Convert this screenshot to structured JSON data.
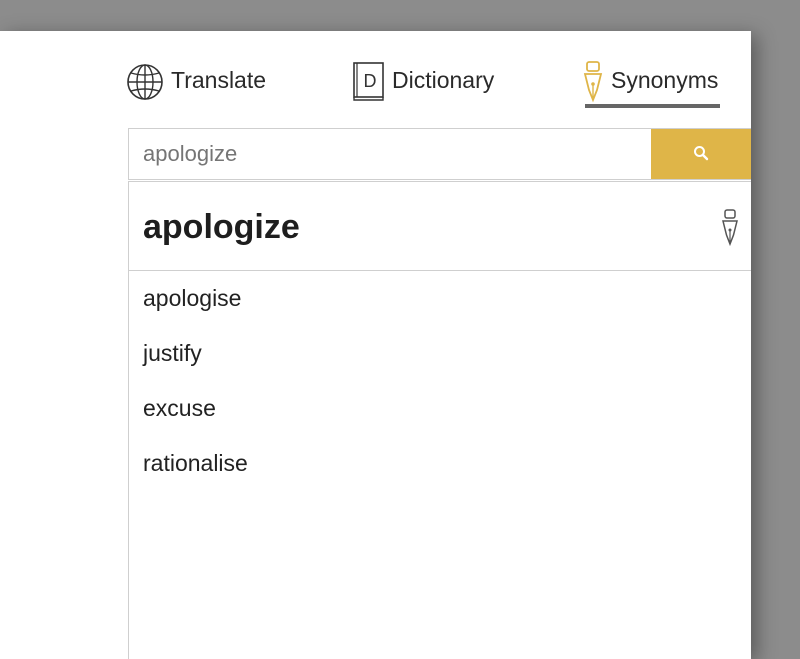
{
  "tabs": {
    "translate": {
      "label": "Translate",
      "icon": "globe-icon"
    },
    "dictionary": {
      "label": "Dictionary",
      "icon": "book-icon"
    },
    "synonyms": {
      "label": "Synonyms",
      "icon": "pen-nib-icon",
      "active": true
    }
  },
  "search": {
    "value": "",
    "placeholder": "apologize",
    "button_icon": "search-icon"
  },
  "result": {
    "headword": "apologize",
    "headword_icon": "pen-nib-icon",
    "synonyms": [
      "apologise",
      "justify",
      "excuse",
      "rationalise"
    ]
  },
  "colors": {
    "accent": "#dfb548",
    "tab_underline": "#666666",
    "border": "#cfcfcf",
    "text": "#222222",
    "placeholder": "#8a8a8a"
  }
}
